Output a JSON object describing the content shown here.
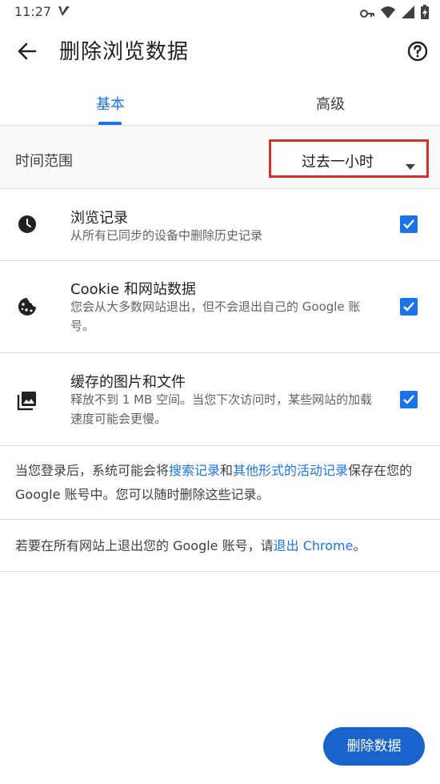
{
  "status_bar": {
    "time": "11:27",
    "icons": [
      "v-notification-icon",
      "key-icon",
      "wifi-icon",
      "signal-icon",
      "battery-charging-icon"
    ]
  },
  "app_bar": {
    "title": "删除浏览数据",
    "back_icon": "arrow-back-icon",
    "help_icon": "help-circle-icon"
  },
  "tabs": [
    {
      "label": "基本",
      "selected": true
    },
    {
      "label": "高级",
      "selected": false
    }
  ],
  "time_range": {
    "label": "时间范围",
    "selected_value": "过去一小时"
  },
  "options": [
    {
      "icon": "clock-icon",
      "title": "浏览记录",
      "desc": "从所有已同步的设备中删除历史记录",
      "checked": true
    },
    {
      "icon": "cookie-icon",
      "title": "Cookie 和网站数据",
      "desc": "您会从大多数网站退出，但不会退出自己的 Google 账号。",
      "checked": true
    },
    {
      "icon": "image-stack-icon",
      "title": "缓存的图片和文件",
      "desc": "释放不到 1 MB 空间。当您下次访问时，某些网站的加载速度可能会更慢。",
      "checked": true
    }
  ],
  "notes": {
    "account_note": {
      "prefix": "当您登录后，系统可能会将",
      "link1": "搜索记录",
      "middle": "和",
      "link2": "其他形式的活动记录",
      "suffix": "保存在您的 Google 账号中。您可以随时删除这些记录。"
    },
    "signout_note": {
      "prefix": "若要在所有网站上退出您的 Google 账号，请",
      "link": "退出 Chrome",
      "suffix": "。"
    }
  },
  "actions": {
    "delete_label": "删除数据"
  },
  "colors": {
    "accent": "#1a73e8",
    "button": "#1a63cc",
    "highlight_border": "#d93025"
  }
}
